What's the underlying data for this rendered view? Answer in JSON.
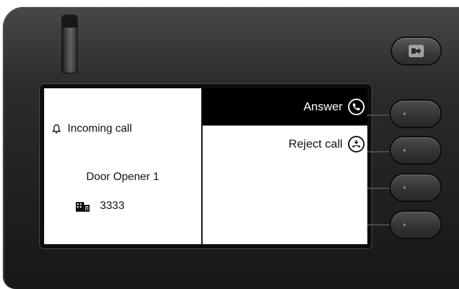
{
  "icons": {
    "logout": "logout-icon",
    "bell": "bell-icon",
    "building": "building-icon",
    "answer": "handset-icon",
    "reject": "hangup-icon"
  },
  "colors": {
    "housing": "#2a2b2d",
    "screen": "#ffffff",
    "selected_bg": "#000000",
    "text": "#111111"
  },
  "left_pane": {
    "status": "Incoming call",
    "caller_name": "Door Opener 1",
    "number": "3333"
  },
  "menu": {
    "options": [
      {
        "label": "Answer",
        "icon": "handset-icon",
        "selected": true
      },
      {
        "label": "Reject call",
        "icon": "hangup-icon",
        "selected": false
      }
    ]
  }
}
